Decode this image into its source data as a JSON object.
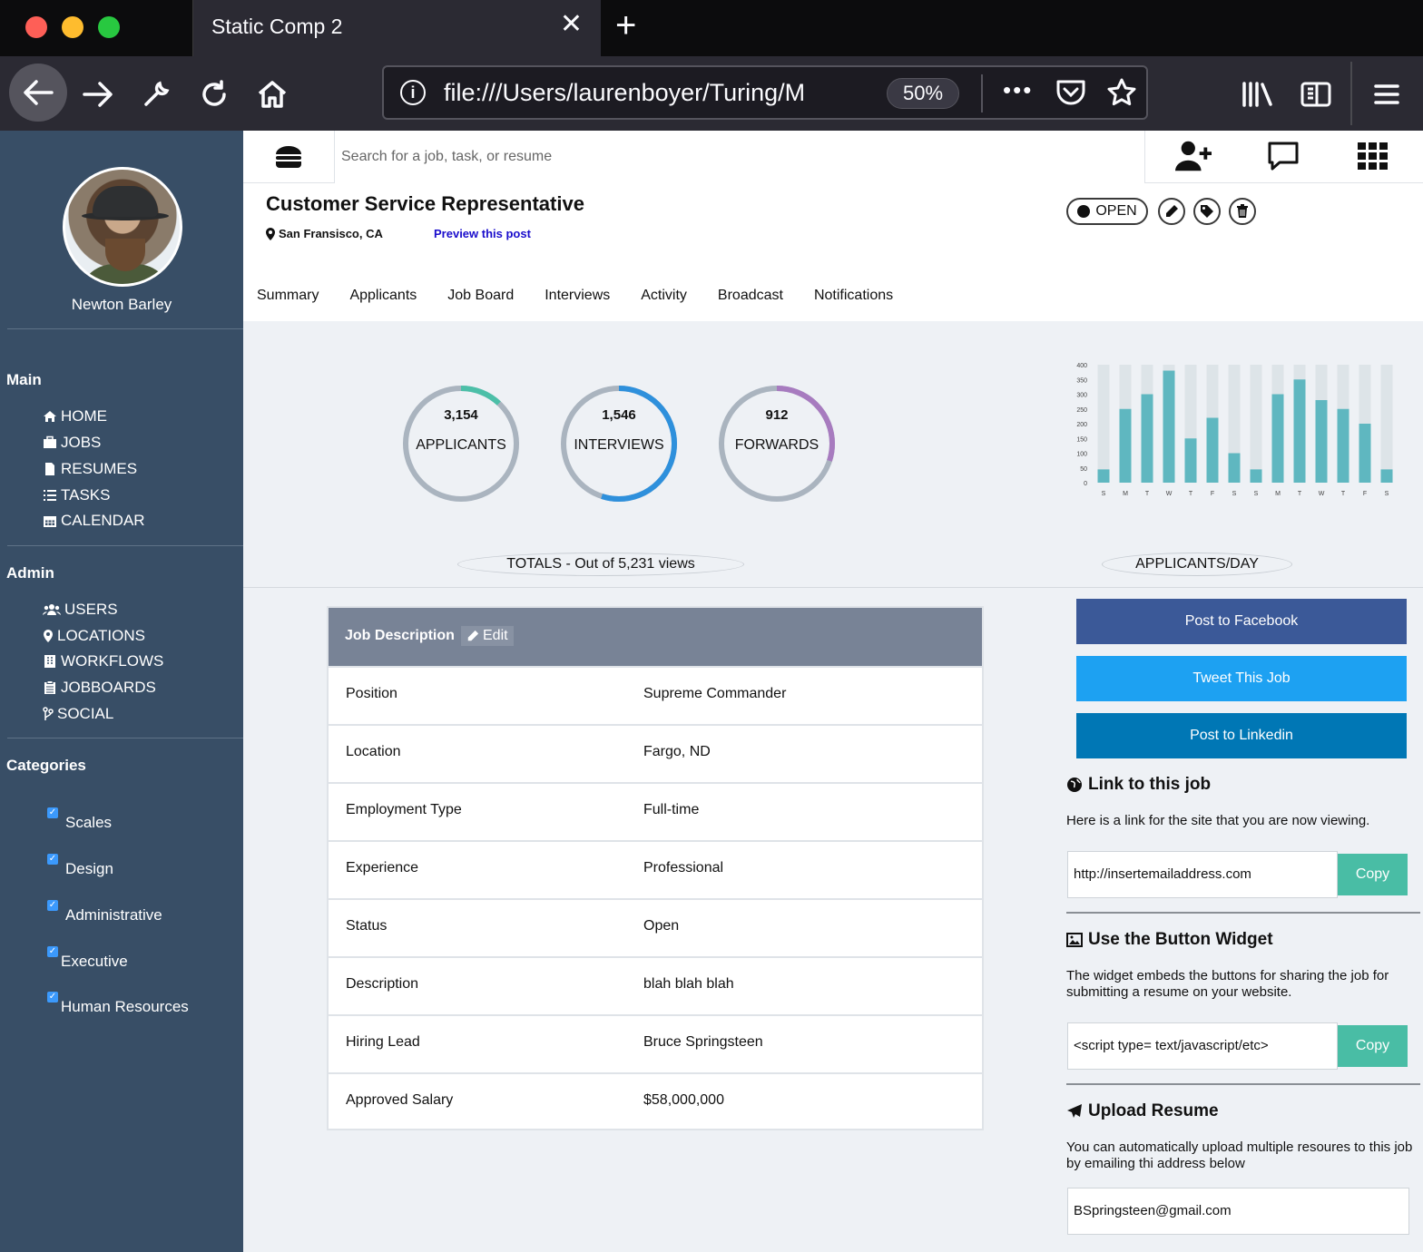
{
  "browser": {
    "tab_title": "Static Comp 2",
    "url": "file:///Users/laurenboyer/Turing/M",
    "zoom": "50%"
  },
  "search": {
    "placeholder": "Search for a job, task, or resume"
  },
  "profile": {
    "name": "Newton Barley"
  },
  "sidebar": {
    "main_heading": "Main",
    "main_items": [
      {
        "label": "HOME",
        "icon": "home-icon"
      },
      {
        "label": "JOBS",
        "icon": "briefcase-icon"
      },
      {
        "label": "RESUMES",
        "icon": "file-icon"
      },
      {
        "label": "TASKS",
        "icon": "list-icon"
      },
      {
        "label": "CALENDAR",
        "icon": "calendar-icon"
      }
    ],
    "admin_heading": "Admin",
    "admin_items": [
      {
        "label": "USERS",
        "icon": "users-icon"
      },
      {
        "label": "LOCATIONS",
        "icon": "map-pin-icon"
      },
      {
        "label": "WORKFLOWS",
        "icon": "building-icon"
      },
      {
        "label": "JOBBOARDS",
        "icon": "clipboard-icon"
      },
      {
        "label": "SOCIAL",
        "icon": "branch-icon"
      }
    ],
    "categories_heading": "Categories",
    "categories": [
      "Scales",
      "Design",
      "Administrative",
      "Executive",
      "Human Resources"
    ]
  },
  "job": {
    "title": "Customer Service Representative",
    "location": "San Fransisco, CA",
    "preview_link": "Preview this post",
    "status_label": "OPEN"
  },
  "tabs": [
    "Summary",
    "Applicants",
    "Job Board",
    "Interviews",
    "Activity",
    "Broadcast",
    "Notifications"
  ],
  "stats": {
    "applicants": {
      "value": "3,154",
      "label": "APPLICANTS",
      "fraction": 0.12,
      "color": "#4cbfa8"
    },
    "interviews": {
      "value": "1,546",
      "label": "INTERVIEWS",
      "fraction": 0.55,
      "color": "#2e90dc"
    },
    "forwards": {
      "value": "912",
      "label": "FORWARDS",
      "fraction": 0.3,
      "color": "#a77bbf"
    },
    "totals_label": "TOTALS - Out of 5,231 views",
    "chart_label": "APPLICANTS/DAY"
  },
  "chart_data": {
    "type": "bar",
    "categories": [
      "S",
      "M",
      "T",
      "W",
      "T",
      "F",
      "S",
      "S",
      "M",
      "T",
      "W",
      "T",
      "F",
      "S"
    ],
    "values": [
      45,
      250,
      300,
      380,
      150,
      220,
      100,
      45,
      300,
      350,
      280,
      250,
      200,
      45
    ],
    "ylim": [
      0,
      400
    ],
    "yticks": [
      0,
      50,
      100,
      150,
      200,
      250,
      300,
      350,
      400
    ],
    "bar_color": "#5fb7c0",
    "track_color": "#dde4e8"
  },
  "job_description": {
    "heading": "Job Description",
    "edit_label": "Edit",
    "rows": [
      {
        "key": "Position",
        "value": "Supreme Commander"
      },
      {
        "key": "Location",
        "value": "Fargo, ND"
      },
      {
        "key": "Employment Type",
        "value": "Full-time"
      },
      {
        "key": "Experience",
        "value": "Professional"
      },
      {
        "key": "Status",
        "value": "Open"
      },
      {
        "key": "Description",
        "value": "blah blah blah"
      },
      {
        "key": "Hiring Lead",
        "value": "Bruce Springsteen"
      },
      {
        "key": "Approved Salary",
        "value": "$58,000,000"
      }
    ]
  },
  "share": {
    "facebook": "Post to Facebook",
    "twitter": "Tweet This Job",
    "linkedin": "Post to Linkedin",
    "colors": {
      "facebook": "#3b5998",
      "twitter": "#1da1f2",
      "linkedin": "#0077b5"
    }
  },
  "link_section": {
    "heading": "Link to this job",
    "text": "Here is a link for the site that you are now viewing.",
    "url": "http://insertemailaddress.com",
    "copy_label": "Copy"
  },
  "widget_section": {
    "heading": "Use the Button Widget",
    "text": "The widget embeds the buttons for sharing the job for submitting a resume on your website.",
    "code": "<script type= text/javascript/etc>",
    "copy_label": "Copy"
  },
  "upload_section": {
    "heading": "Upload Resume",
    "text": "You can automatically upload multiple resoures to this job by emailing thi address below",
    "email": "BSpringsteen@gmail.com"
  }
}
